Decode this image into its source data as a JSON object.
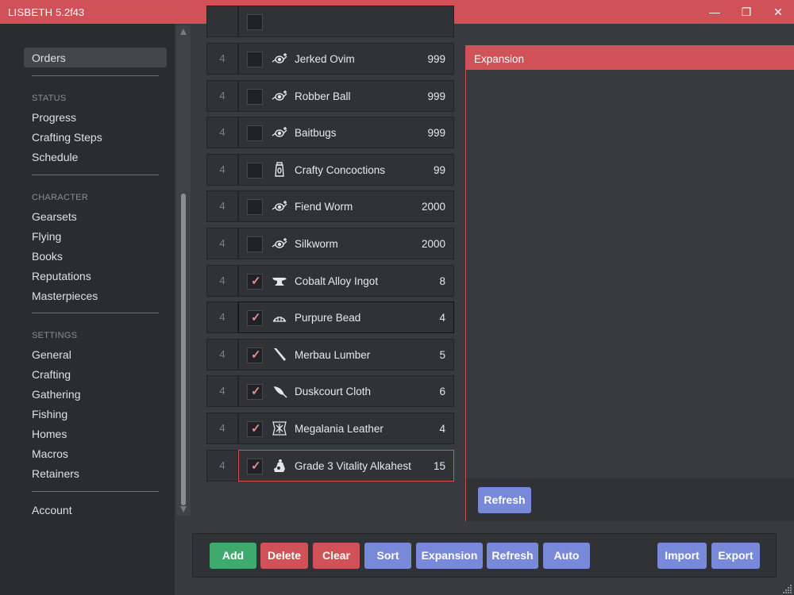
{
  "app": {
    "name": "LISBETH",
    "version": "5.2f43"
  },
  "window_controls": {
    "minimize": "—",
    "maximize": "❐",
    "close": "✕"
  },
  "sidebar": {
    "active": "Orders",
    "status_label": "STATUS",
    "status_items": [
      "Progress",
      "Crafting Steps",
      "Schedule"
    ],
    "character_label": "CHARACTER",
    "character_items": [
      "Gearsets",
      "Flying",
      "Books",
      "Reputations",
      "Masterpieces"
    ],
    "settings_label": "SETTINGS",
    "settings_items": [
      "General",
      "Crafting",
      "Gathering",
      "Fishing",
      "Homes",
      "Macros",
      "Retainers"
    ],
    "account": "Account"
  },
  "orders": [
    {
      "num": "4",
      "name": "Jerked Ovim",
      "qty": "999",
      "checked": false,
      "icon": "fishing-icon"
    },
    {
      "num": "4",
      "name": "Robber Ball",
      "qty": "999",
      "checked": false,
      "icon": "fishing-icon"
    },
    {
      "num": "4",
      "name": "Baitbugs",
      "qty": "999",
      "checked": false,
      "icon": "fishing-icon"
    },
    {
      "num": "4",
      "name": "Crafty Concoctions",
      "qty": "99",
      "checked": false,
      "icon": "potion-icon"
    },
    {
      "num": "4",
      "name": "Fiend Worm",
      "qty": "2000",
      "checked": false,
      "icon": "fishing-icon"
    },
    {
      "num": "4",
      "name": "Silkworm",
      "qty": "2000",
      "checked": false,
      "icon": "fishing-icon"
    },
    {
      "num": "4",
      "name": "Cobalt Alloy Ingot",
      "qty": "8",
      "checked": true,
      "icon": "anvil-icon"
    },
    {
      "num": "4",
      "name": "Purpure Bead",
      "qty": "4",
      "checked": true,
      "icon": "crown-icon"
    },
    {
      "num": "4",
      "name": "Merbau Lumber",
      "qty": "5",
      "checked": true,
      "icon": "saw-icon"
    },
    {
      "num": "4",
      "name": "Duskcourt Cloth",
      "qty": "6",
      "checked": true,
      "icon": "needle-icon"
    },
    {
      "num": "4",
      "name": "Megalania Leather",
      "qty": "4",
      "checked": true,
      "icon": "leather-icon"
    },
    {
      "num": "4",
      "name": "Grade 3 Vitality Alkahest",
      "qty": "15",
      "checked": true,
      "icon": "alchemy-icon"
    }
  ],
  "expansion": {
    "title": "Expansion",
    "refresh": "Refresh"
  },
  "toolbar": {
    "add": "Add",
    "delete": "Delete",
    "clear": "Clear",
    "sort": "Sort",
    "expansion": "Expansion",
    "refresh": "Refresh",
    "auto": "Auto",
    "import": "Import",
    "export": "Export"
  },
  "colors": {
    "accent": "#d05157",
    "button_blue": "#7789d8",
    "button_green": "#3eaa6e",
    "check": "#e58c92"
  }
}
